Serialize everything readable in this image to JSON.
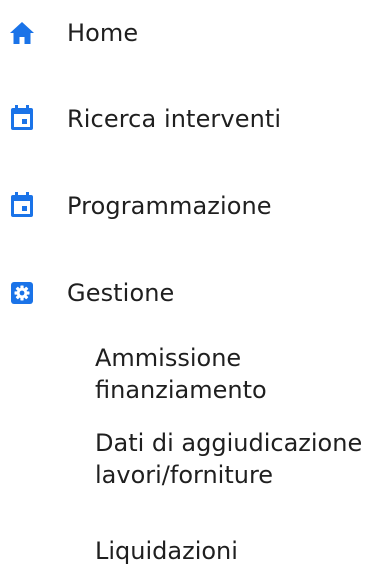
{
  "accent_color": "#1a73e8",
  "menu": {
    "items": [
      {
        "label": "Home",
        "icon": "home-icon"
      },
      {
        "label": "Ricerca interventi",
        "icon": "calendar-icon"
      },
      {
        "label": "Programmazione",
        "icon": "calendar-icon"
      },
      {
        "label": "Gestione",
        "icon": "settings-icon"
      }
    ],
    "gestione_sub": [
      {
        "line1": "Ammissione",
        "line2": "finanziamento"
      },
      {
        "line1": "Dati di aggiudicazione",
        "line2": "lavori/forniture"
      },
      {
        "line1": "Liquidazioni"
      }
    ]
  }
}
